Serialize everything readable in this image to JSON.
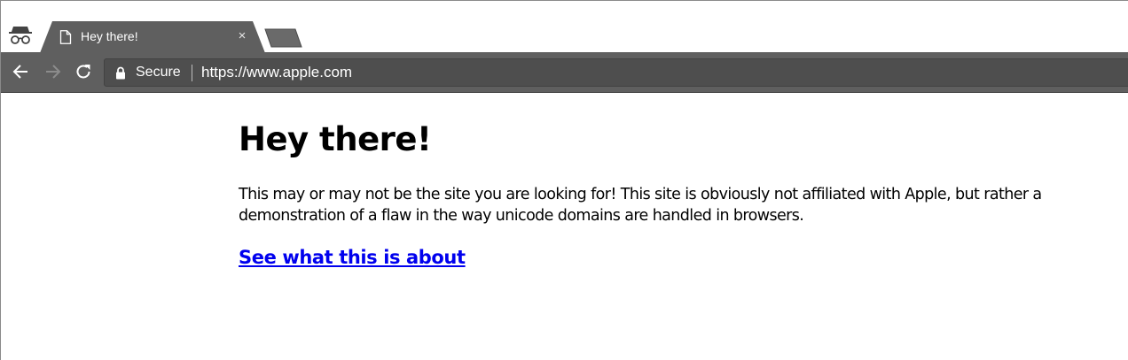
{
  "browser": {
    "tab": {
      "title": "Hey there!",
      "close_glyph": "×",
      "icon": "page-icon"
    },
    "incognito_icon": "incognito-icon",
    "toolbar": {
      "back_icon": "back-arrow-icon",
      "forward_icon": "forward-arrow-icon",
      "reload_icon": "reload-icon"
    },
    "omnibox": {
      "security_icon": "lock-icon",
      "security_label": "Secure",
      "url": "https://www.apple.com"
    },
    "colors": {
      "chrome_dark": "#5f5f5f",
      "link": "#0000ee"
    }
  },
  "page": {
    "heading": "Hey there!",
    "paragraph": "This may or may not be the site you are looking for! This site is obviously not affiliated with Apple, but rather a demonstration of a flaw in the way unicode domains are handled in browsers.",
    "link_text": "See what this is about"
  }
}
